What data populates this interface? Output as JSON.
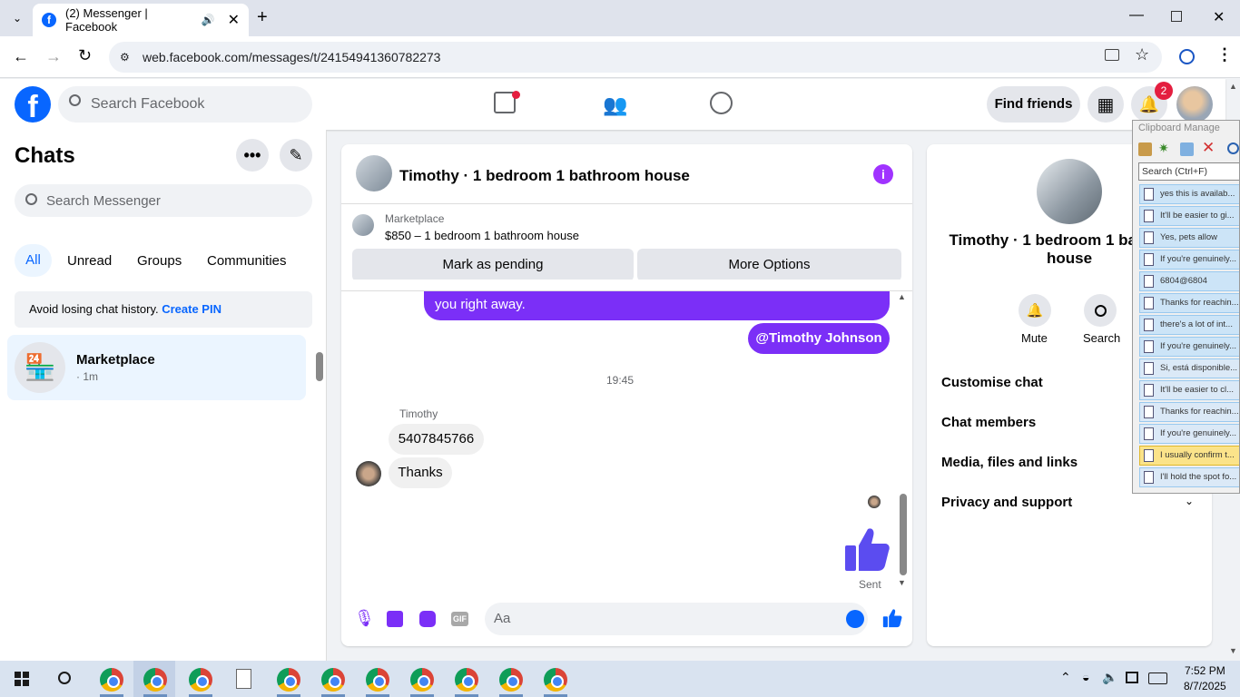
{
  "browser": {
    "tab_title": "(2) Messenger | Facebook",
    "url": "web.facebook.com/messages/t/24154941360782273"
  },
  "fb": {
    "search_placeholder": "Search Facebook",
    "find_friends": "Find friends",
    "notif_count": "2"
  },
  "chats": {
    "title": "Chats",
    "search_placeholder": "Search Messenger",
    "filters": [
      "All",
      "Unread",
      "Groups",
      "Communities"
    ],
    "pin_text": "Avoid losing chat history.",
    "pin_link": "Create PIN",
    "item_name": "Marketplace",
    "item_time": "· 1m"
  },
  "conversation": {
    "title": "Timothy · 1 bedroom 1 bathroom house",
    "market_label": "Marketplace",
    "market_listing": "$850 – 1 bedroom 1 bathroom house",
    "btn_pending": "Mark as pending",
    "btn_more": "More Options",
    "partial_msg": "you right away.",
    "mention": "@Timothy Johnson",
    "time": "19:45",
    "sender": "Timothy",
    "msg1": "5407845766",
    "msg2": "Thanks",
    "sent": "Sent",
    "composer_placeholder": "Aa"
  },
  "info": {
    "name": "Timothy · 1 bedroom 1 bathroom house",
    "mute": "Mute",
    "search": "Search",
    "sections": [
      "Customise chat",
      "Chat members",
      "Media, files and links",
      "Privacy and support"
    ]
  },
  "clipboard": {
    "title": "Clipboard Manage",
    "search": "Search (Ctrl+F)",
    "items": [
      "yes this is  availab...",
      "It'll be easier to gi...",
      "Yes, pets allow",
      "If you're genuinely...",
      "6804@6804",
      "Thanks for reachin...",
      "there's a lot of int...",
      "If you're genuinely...",
      "Si, está disponible...",
      "It'll be easier to cl...",
      "Thanks for reachin...",
      "If you're genuinely...",
      "I usually confirm t...",
      "I'll hold the spot fo..."
    ]
  },
  "taskbar": {
    "time": "7:52 PM",
    "date": "8/7/2025"
  },
  "colors": {
    "fb_blue": "#0866ff",
    "purple": "#7b2ff7",
    "accent_thumb": "#5b4cf0"
  }
}
